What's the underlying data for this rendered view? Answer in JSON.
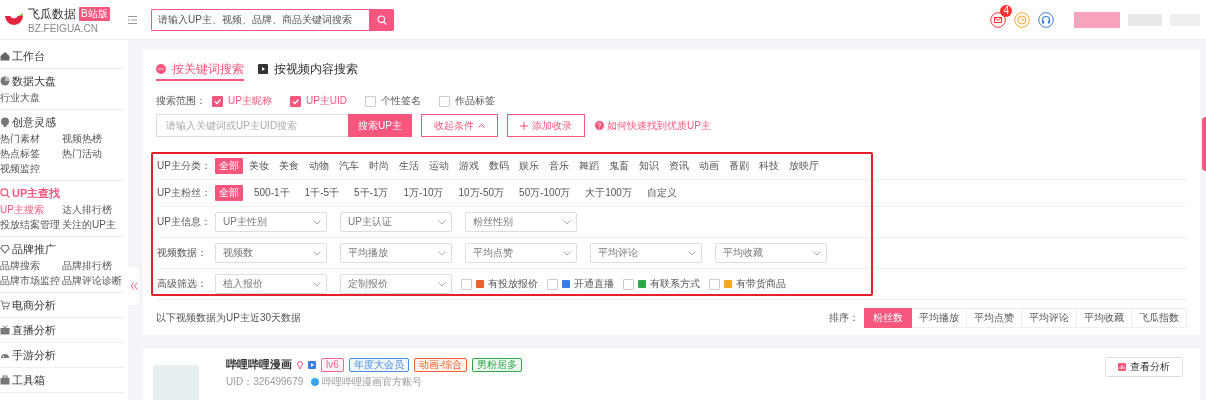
{
  "header": {
    "logo_title": "飞瓜数据",
    "logo_badge": "B站版",
    "logo_domain": "BZ.FEIGUA.CN",
    "search": {
      "placeholder": "请输入UP主、视频、品牌、商品关键词搜索"
    },
    "mail_badge": "4"
  },
  "sidebar": {
    "groups": [
      {
        "title": "工作台",
        "selected": false
      },
      {
        "title": "数据大盘",
        "selected": false,
        "items": [
          {
            "label": "行业大盘",
            "selected": false
          }
        ]
      },
      {
        "title": "创意灵感",
        "selected": false,
        "items": [
          {
            "label": "热门素材",
            "selected": false
          },
          {
            "label": "视频热榜",
            "selected": false
          },
          {
            "label": "热点标签",
            "selected": false
          },
          {
            "label": "热门活动",
            "selected": false
          },
          {
            "label": "视频监控",
            "selected": false
          }
        ]
      },
      {
        "title": "UP主查找",
        "selected": true,
        "items": [
          {
            "label": "UP主搜索",
            "selected": true
          },
          {
            "label": "达人排行榜",
            "selected": false
          },
          {
            "label": "投放结案管理",
            "selected": false
          },
          {
            "label": "关注的UP主",
            "selected": false
          }
        ]
      },
      {
        "title": "品牌推广",
        "selected": false,
        "items": [
          {
            "label": "品牌搜索",
            "selected": false
          },
          {
            "label": "品牌排行榜",
            "selected": false
          },
          {
            "label": "品牌市场监控",
            "selected": false
          },
          {
            "label": "品牌评论诊断",
            "selected": false
          }
        ]
      },
      {
        "title": "电商分析",
        "selected": false
      },
      {
        "title": "直播分析",
        "selected": false
      },
      {
        "title": "手游分析",
        "selected": false
      },
      {
        "title": "工具箱",
        "selected": false
      }
    ]
  },
  "main": {
    "search_tabs": [
      {
        "label": "按关键词搜索",
        "selected": true
      },
      {
        "label": "按视频内容搜索",
        "selected": false
      }
    ],
    "scope": {
      "label": "搜索范围：",
      "options": [
        {
          "label": "UP主昵称",
          "checked": true
        },
        {
          "label": "UP主UID",
          "checked": true
        },
        {
          "label": "个性签名",
          "checked": false
        },
        {
          "label": "作品标签",
          "checked": false
        }
      ]
    },
    "keyword_input": {
      "placeholder": "请输入关键词或UP主UID搜索"
    },
    "search_button": "搜索UP主",
    "collapse_button": "收起条件",
    "add_button": "添加收录",
    "help_link": "如何快速找到优质UP主",
    "filters": [
      {
        "kind": "chips",
        "label": "UP主分类：",
        "options": [
          {
            "label": "全部",
            "selected": true
          },
          {
            "label": "美妆",
            "selected": false
          },
          {
            "label": "美食",
            "selected": false
          },
          {
            "label": "动物",
            "selected": false
          },
          {
            "label": "汽车",
            "selected": false
          },
          {
            "label": "时尚",
            "selected": false
          },
          {
            "label": "生活",
            "selected": false
          },
          {
            "label": "运动",
            "selected": false
          },
          {
            "label": "游戏",
            "selected": false
          },
          {
            "label": "数码",
            "selected": false
          },
          {
            "label": "娱乐",
            "selected": false
          },
          {
            "label": "音乐",
            "selected": false
          },
          {
            "label": "舞蹈",
            "selected": false
          },
          {
            "label": "鬼畜",
            "selected": false
          },
          {
            "label": "知识",
            "selected": false
          },
          {
            "label": "资讯",
            "selected": false
          },
          {
            "label": "动画",
            "selected": false
          },
          {
            "label": "番剧",
            "selected": false
          },
          {
            "label": "科技",
            "selected": false
          },
          {
            "label": "放映厅",
            "selected": false
          }
        ]
      },
      {
        "kind": "chips",
        "label": "UP主粉丝：",
        "options": [
          {
            "label": "全部",
            "selected": true
          },
          {
            "label": "500-1千",
            "selected": false
          },
          {
            "label": "1千-5千",
            "selected": false
          },
          {
            "label": "5千-1万",
            "selected": false
          },
          {
            "label": "1万-10万",
            "selected": false
          },
          {
            "label": "10万-50万",
            "selected": false
          },
          {
            "label": "50万-100万",
            "selected": false
          },
          {
            "label": "大于100万",
            "selected": false
          },
          {
            "label": "自定义",
            "selected": false
          }
        ]
      },
      {
        "kind": "selects",
        "label": "UP主信息：",
        "selects": [
          {
            "placeholder": "UP主性别"
          },
          {
            "placeholder": "UP主认证"
          },
          {
            "placeholder": "粉丝性别"
          }
        ]
      },
      {
        "kind": "selects",
        "label": "视频数据：",
        "selects": [
          {
            "placeholder": "视频数"
          },
          {
            "placeholder": "平均播放"
          },
          {
            "placeholder": "平均点赞"
          },
          {
            "placeholder": "平均评论"
          },
          {
            "placeholder": "平均收藏"
          }
        ]
      },
      {
        "kind": "selects",
        "label": "高级筛选：",
        "selects": [
          {
            "placeholder": "植入报价"
          },
          {
            "placeholder": "定制报价"
          }
        ],
        "checks": [
          {
            "label": "有投放报价",
            "checked": false,
            "color": "#f0602a"
          },
          {
            "label": "开通直播",
            "checked": false,
            "color": "#3b7de8"
          },
          {
            "label": "有联系方式",
            "checked": false,
            "color": "#2aa84a"
          },
          {
            "label": "有带货商品",
            "checked": false,
            "color": "#f5a623"
          }
        ]
      }
    ],
    "note": "以下视频数据为UP主近30天数据",
    "sort": {
      "label": "排序：",
      "options": [
        {
          "label": "粉丝数",
          "selected": true
        },
        {
          "label": "平均播放",
          "selected": false
        },
        {
          "label": "平均点赞",
          "selected": false
        },
        {
          "label": "平均评论",
          "selected": false
        },
        {
          "label": "平均收藏",
          "selected": false
        },
        {
          "label": "飞瓜指数",
          "selected": false
        }
      ]
    }
  },
  "results": [
    {
      "name": "哔哩哔哩漫画",
      "tags": [
        {
          "label": "lv6",
          "color": "#f06292"
        },
        {
          "label": "年度大会员",
          "color": "#4a90e2"
        },
        {
          "label": "动画-综合",
          "color": "#f0602a"
        },
        {
          "label": "男粉居多",
          "color": "#2aa84a"
        }
      ],
      "uid": "UID：326499679",
      "verified": "哔哩哔哩漫画官方账号",
      "action": "查看分析"
    }
  ]
}
